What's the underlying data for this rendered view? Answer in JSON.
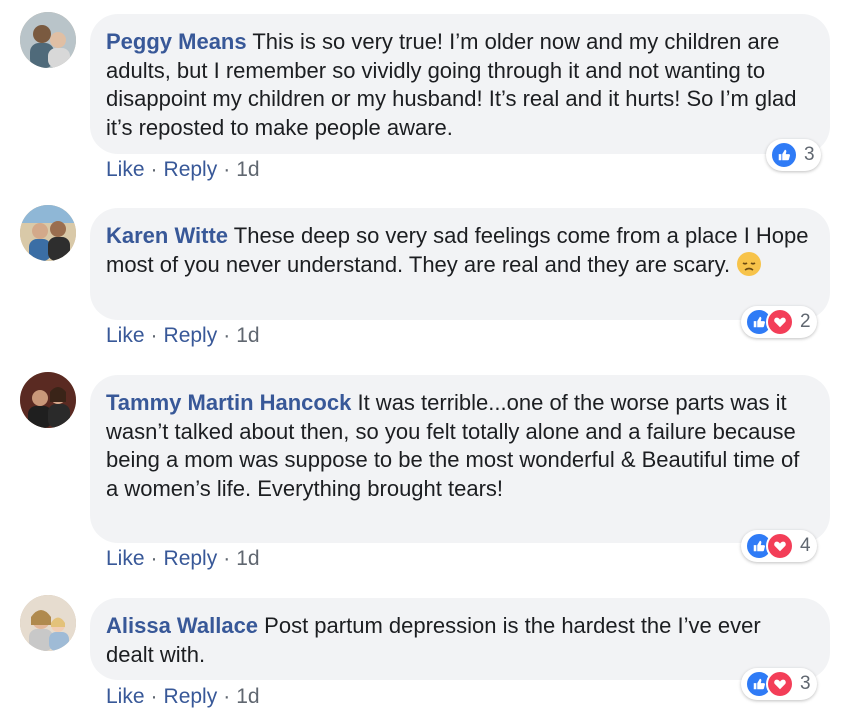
{
  "comments": [
    {
      "author": "Peggy Means",
      "text": "This is so very true! I’m older now and my children are adults, but I remember so vividly going through it and not wanting to disappoint my children or my husband! It’s real and it hurts! So I’m glad it’s reposted to make people aware.",
      "like_label": "Like",
      "reply_label": "Reply",
      "time": "1d",
      "reaction_count": "3",
      "reactions": [
        "like"
      ]
    },
    {
      "author": "Karen Witte",
      "text": "These deep so very sad feelings come from a place I Hope most of you never understand. They are real and they are scary.",
      "emoji": "disappointed-face",
      "like_label": "Like",
      "reply_label": "Reply",
      "time": "1d",
      "reaction_count": "2",
      "reactions": [
        "like",
        "love"
      ]
    },
    {
      "author": "Tammy Martin Hancock",
      "text": "It was terrible...one of the worse parts was it wasn’t talked about then, so you felt totally alone and a failure because being a mom was suppose to be the most wonderful & Beautiful time of a women’s life. Everything brought tears!",
      "like_label": "Like",
      "reply_label": "Reply",
      "time": "1d",
      "reaction_count": "4",
      "reactions": [
        "like",
        "love"
      ]
    },
    {
      "author": "Alissa Wallace",
      "text": "Post partum depression is the hardest the I’ve ever dealt with.",
      "like_label": "Like",
      "reply_label": "Reply",
      "time": "1d",
      "reaction_count": "3",
      "reactions": [
        "like",
        "love"
      ]
    }
  ],
  "colors": {
    "author": "#385898",
    "bubble": "#f2f3f5",
    "like_reaction": "#2f7bf6",
    "love_reaction": "#f33e58",
    "meta": "#606770"
  }
}
